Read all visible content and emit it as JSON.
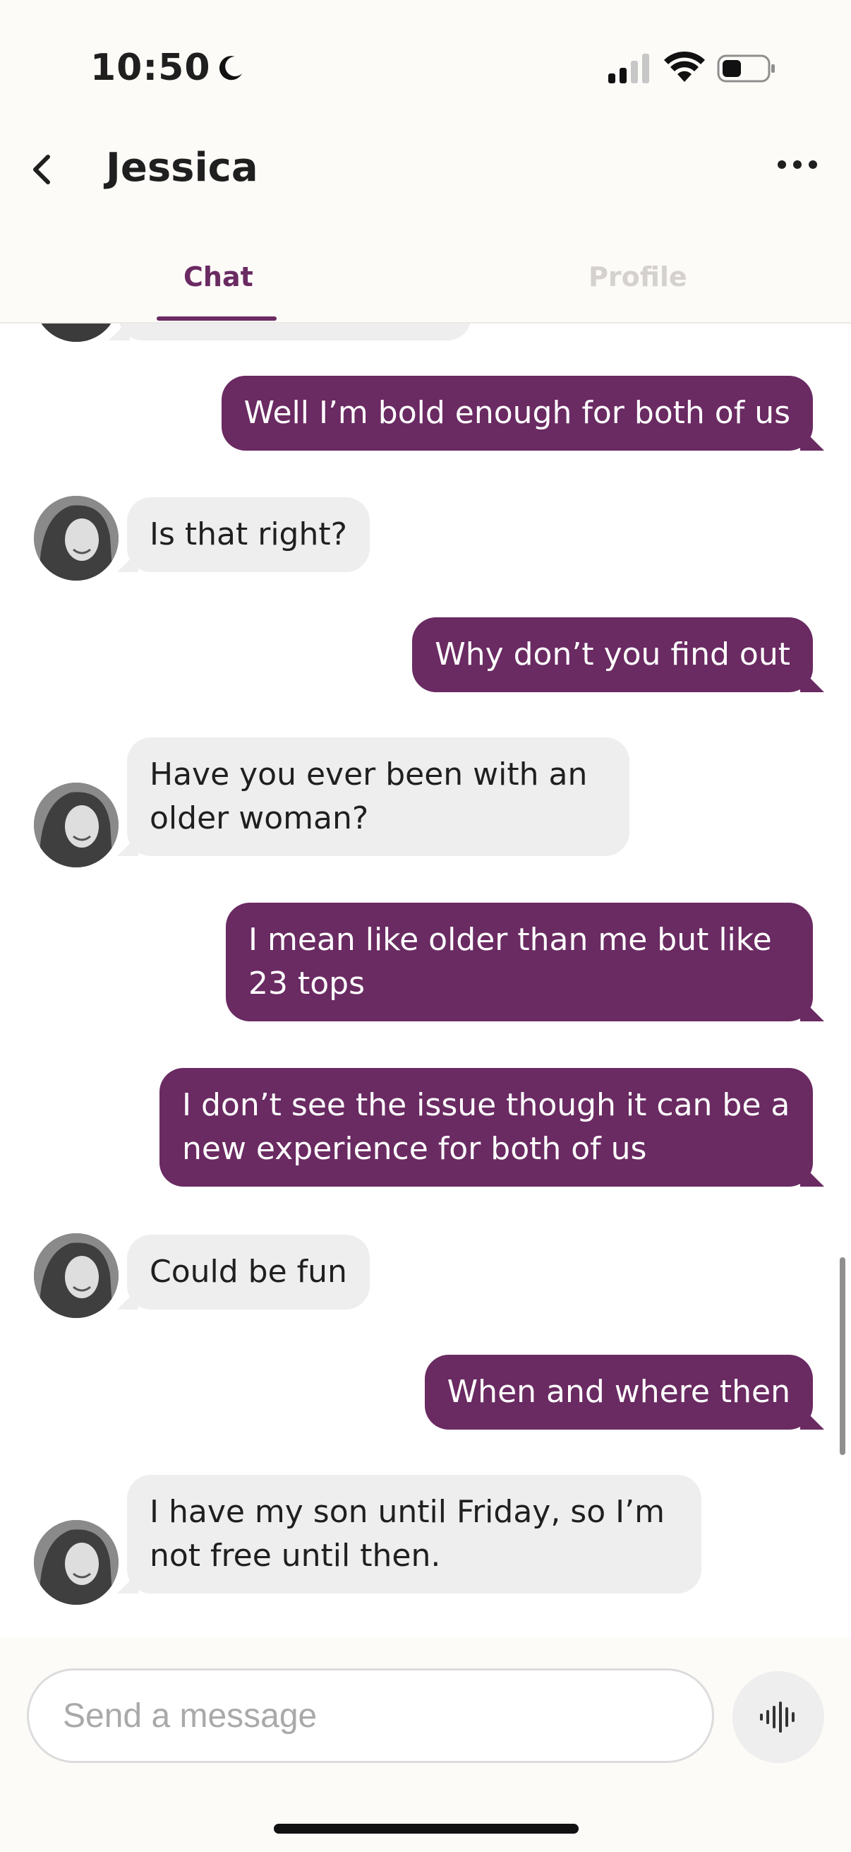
{
  "status_bar": {
    "time": "10:50"
  },
  "header": {
    "title": "Jessica"
  },
  "tabs": [
    {
      "label": "Chat"
    },
    {
      "label": "Profile"
    }
  ],
  "messages": [
    {
      "from": "me",
      "text": "Well I’m bold enough for both of us"
    },
    {
      "from": "them",
      "text": "Is that right?"
    },
    {
      "from": "me",
      "text": "Why don’t you find out"
    },
    {
      "from": "them",
      "text": "Have you ever been with an older woman?"
    },
    {
      "from": "me",
      "text": "I mean like older than me but like 23 tops"
    },
    {
      "from": "me",
      "text": "I don’t see the issue though it can be a new experience for both of us"
    },
    {
      "from": "them",
      "text": "Could be fun"
    },
    {
      "from": "me",
      "text": "When and where then"
    },
    {
      "from": "them",
      "text": "I have my son until Friday, so I’m not free until then."
    }
  ],
  "composer": {
    "placeholder": "Send a message"
  },
  "colors": {
    "accent": "#6a2a62",
    "incoming_bubble": "#eeeeee",
    "outgoing_bubble": "#6a2a62"
  }
}
